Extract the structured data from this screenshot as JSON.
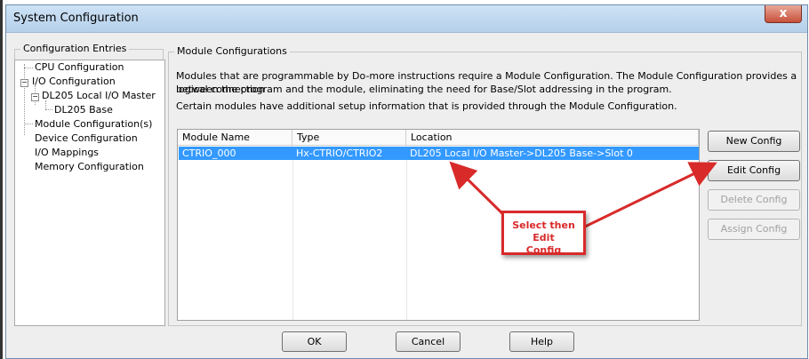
{
  "window": {
    "title": "System Configuration",
    "close_label": "x"
  },
  "sidebar": {
    "group_label": "Configuration Entries",
    "items": [
      {
        "label": "CPU Configuration",
        "expander": ""
      },
      {
        "label": "I/O Configuration",
        "expander": "−"
      },
      {
        "label": "DL205 Local I/O Master",
        "expander": "−"
      },
      {
        "label": "DL205 Base",
        "expander": ""
      },
      {
        "label": "Module Configuration(s)",
        "expander": ""
      },
      {
        "label": "Device Configuration",
        "expander": ""
      },
      {
        "label": "I/O Mappings",
        "expander": ""
      },
      {
        "label": "Memory Configuration",
        "expander": ""
      }
    ]
  },
  "main": {
    "group_label": "Module Configurations",
    "description_line1": "Modules that are programmable by Do-more instructions require a Module Configuration. The Module Configuration provides a logical connection",
    "description_line2": "between the program and the module, eliminating the need for Base/Slot addressing in the program.",
    "description_line3": "Certain modules have additional setup information that is provided through the Module Configuration.",
    "table": {
      "headers": [
        "Module Name",
        "Type",
        "Location"
      ],
      "rows": [
        {
          "name": "CTRIO_000",
          "type": "Hx-CTRIO/CTRIO2",
          "location": "DL205 Local I/O Master->DL205 Base->Slot 0"
        }
      ]
    },
    "buttons": {
      "new_config": "New Config",
      "edit_config": "Edit Config",
      "delete_config": "Delete Config",
      "assign_config": "Assign Config"
    }
  },
  "footer": {
    "ok": "OK",
    "cancel": "Cancel",
    "help": "Help"
  },
  "annotation": {
    "line1": "Select then Edit",
    "line2": "Config",
    "color": "#d92a2a"
  }
}
